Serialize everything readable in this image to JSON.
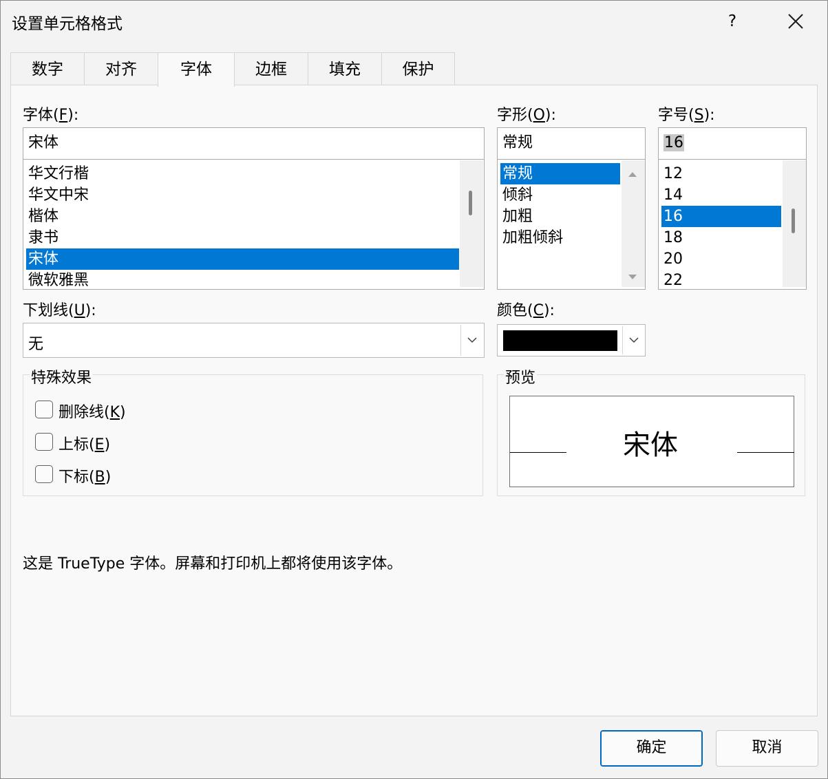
{
  "dialog": {
    "title": "设置单元格格式",
    "help_label": "?"
  },
  "tabs": [
    {
      "label": "数字"
    },
    {
      "label": "对齐"
    },
    {
      "label": "字体"
    },
    {
      "label": "边框"
    },
    {
      "label": "填充"
    },
    {
      "label": "保护"
    }
  ],
  "font": {
    "label": "字体(",
    "key": "F",
    "label_end": "):",
    "value": "宋体",
    "items": [
      "华文行楷",
      "华文中宋",
      "楷体",
      "隶书",
      "宋体",
      "微软雅黑"
    ],
    "selected_index": 4
  },
  "style": {
    "label": "字形(",
    "key": "O",
    "label_end": "):",
    "value": "常规",
    "items": [
      "常规",
      "倾斜",
      "加粗",
      "加粗倾斜"
    ],
    "selected_index": 0
  },
  "size": {
    "label": "字号(",
    "key": "S",
    "label_end": "):",
    "value": "16",
    "items": [
      "12",
      "14",
      "16",
      "18",
      "20",
      "22"
    ],
    "selected_index": 2
  },
  "underline": {
    "label": "下划线(",
    "key": "U",
    "label_end": "):",
    "value": "无"
  },
  "color": {
    "label": "颜色(",
    "key": "C",
    "label_end": "):",
    "swatch": "#000000"
  },
  "effects": {
    "title": "特殊效果",
    "items": [
      {
        "label": "删除线(",
        "key": "K",
        "end": ")",
        "checked": false
      },
      {
        "label": "上标(",
        "key": "E",
        "end": ")",
        "checked": false
      },
      {
        "label": "下标(",
        "key": "B",
        "end": ")",
        "checked": false
      }
    ]
  },
  "preview": {
    "title": "预览",
    "sample": "宋体"
  },
  "info_text": "这是 TrueType 字体。屏幕和打印机上都将使用该字体。",
  "buttons": {
    "ok": "确定",
    "cancel": "取消"
  },
  "colors": {
    "selection": "#0078d4",
    "default_button_border": "#0067c0"
  }
}
